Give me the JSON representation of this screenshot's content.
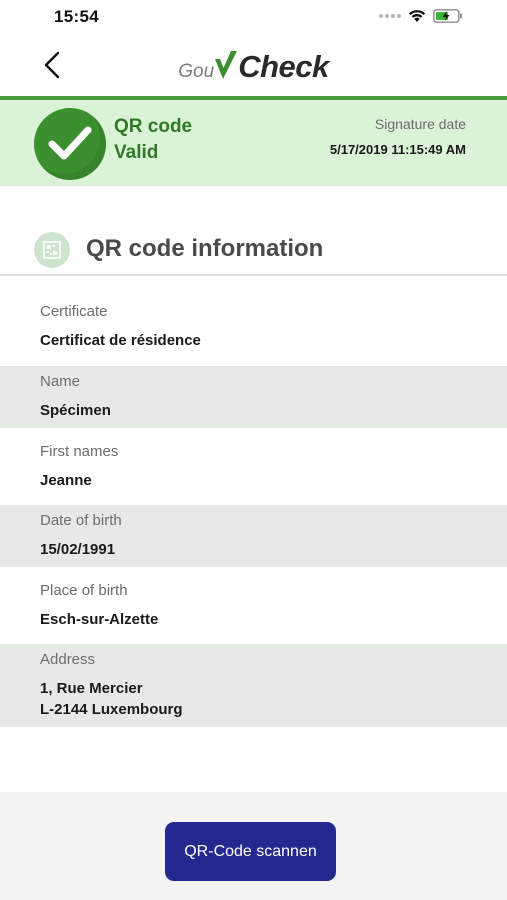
{
  "status_bar": {
    "time": "15:54"
  },
  "nav": {
    "logo_prefix": "Gou",
    "logo_suffix": "Check"
  },
  "validation": {
    "title": "QR code",
    "status": "Valid",
    "signature_label": "Signature date",
    "signature_value": "5/17/2019 11:15:49 AM"
  },
  "section": {
    "title": "QR code information"
  },
  "fields": [
    {
      "label": "Certificate",
      "value": "Certificat de résidence"
    },
    {
      "label": "Name",
      "value": "Spécimen"
    },
    {
      "label": "First names",
      "value": "Jeanne"
    },
    {
      "label": "Date of birth",
      "value": "15/02/1991"
    },
    {
      "label": "Place of birth",
      "value": "Esch-sur-Alzette"
    },
    {
      "label": "Address",
      "value_line1": "1, Rue Mercier",
      "value_line2": "L-2144 Luxembourg"
    }
  ],
  "actions": {
    "scan_label": "QR-Code scannen"
  },
  "colors": {
    "accent_green": "#3b8f2f",
    "banner_bg": "#daf2d6",
    "button_blue": "#23298e"
  }
}
